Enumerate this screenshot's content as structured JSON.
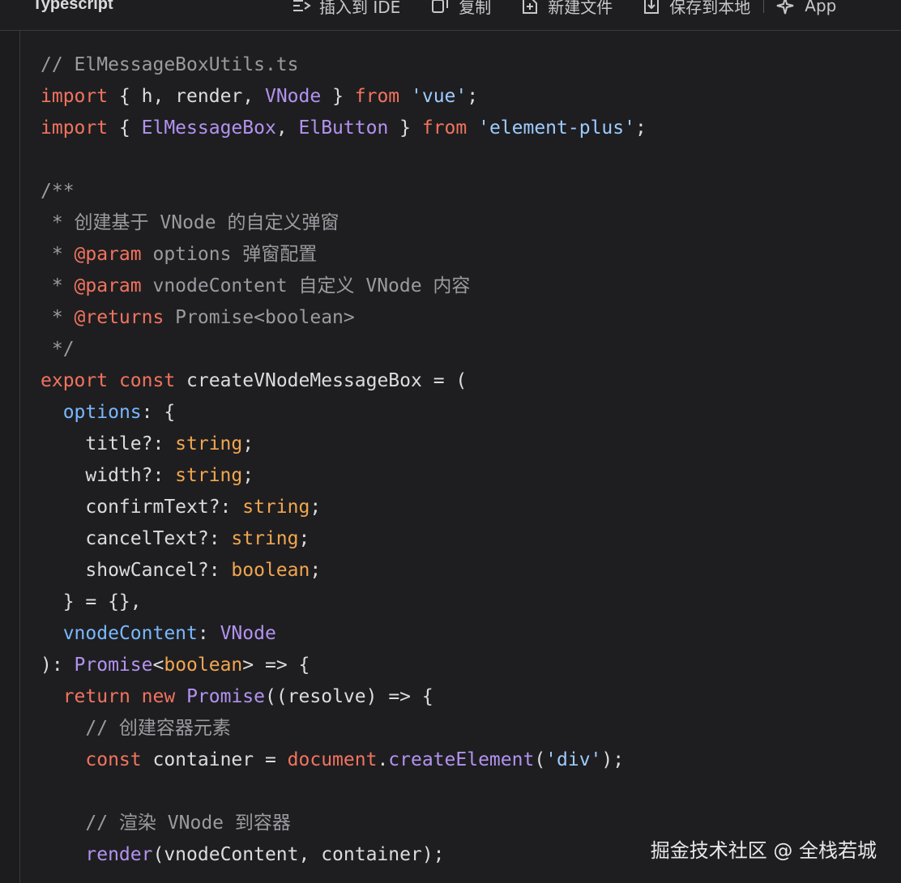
{
  "header": {
    "language": "Typescript",
    "toolbar": {
      "insert_label": "插入到 IDE",
      "copy_label": "复制",
      "new_file_label": "新建文件",
      "save_local_label": "保存到本地",
      "apply_label": "App"
    }
  },
  "code": {
    "lines": [
      [
        {
          "t": "// ElMessageBoxUtils.ts",
          "c": "c"
        }
      ],
      [
        {
          "t": "import",
          "c": "k"
        },
        {
          "t": " { h, render, ",
          "c": ""
        },
        {
          "t": "VNode",
          "c": "p"
        },
        {
          "t": " } ",
          "c": ""
        },
        {
          "t": "from",
          "c": "k"
        },
        {
          "t": " ",
          "c": ""
        },
        {
          "t": "'vue'",
          "c": "s"
        },
        {
          "t": ";",
          "c": ""
        }
      ],
      [
        {
          "t": "import",
          "c": "k"
        },
        {
          "t": " { ",
          "c": ""
        },
        {
          "t": "ElMessageBox",
          "c": "p"
        },
        {
          "t": ", ",
          "c": ""
        },
        {
          "t": "ElButton",
          "c": "p"
        },
        {
          "t": " } ",
          "c": ""
        },
        {
          "t": "from",
          "c": "k"
        },
        {
          "t": " ",
          "c": ""
        },
        {
          "t": "'element-plus'",
          "c": "s"
        },
        {
          "t": ";",
          "c": ""
        }
      ],
      [],
      [
        {
          "t": "/**",
          "c": "d"
        }
      ],
      [
        {
          "t": " * 创建基于 VNode 的自定义弹窗",
          "c": "d"
        }
      ],
      [
        {
          "t": " * ",
          "c": "d"
        },
        {
          "t": "@param",
          "c": "m"
        },
        {
          "t": " options 弹窗配置",
          "c": "d"
        }
      ],
      [
        {
          "t": " * ",
          "c": "d"
        },
        {
          "t": "@param",
          "c": "m"
        },
        {
          "t": " vnodeContent 自定义 VNode 内容",
          "c": "d"
        }
      ],
      [
        {
          "t": " * ",
          "c": "d"
        },
        {
          "t": "@returns",
          "c": "m"
        },
        {
          "t": " Promise<boolean>",
          "c": "d"
        }
      ],
      [
        {
          "t": " */",
          "c": "d"
        }
      ],
      [
        {
          "t": "export",
          "c": "k"
        },
        {
          "t": " ",
          "c": ""
        },
        {
          "t": "const",
          "c": "k"
        },
        {
          "t": " createVNodeMessageBox = (",
          "c": ""
        }
      ],
      [
        {
          "t": "  ",
          "c": ""
        },
        {
          "t": "options",
          "c": "b"
        },
        {
          "t": ": {",
          "c": ""
        }
      ],
      [
        {
          "t": "    title?: ",
          "c": ""
        },
        {
          "t": "string",
          "c": "t"
        },
        {
          "t": ";",
          "c": ""
        }
      ],
      [
        {
          "t": "    width?: ",
          "c": ""
        },
        {
          "t": "string",
          "c": "t"
        },
        {
          "t": ";",
          "c": ""
        }
      ],
      [
        {
          "t": "    confirmText?: ",
          "c": ""
        },
        {
          "t": "string",
          "c": "t"
        },
        {
          "t": ";",
          "c": ""
        }
      ],
      [
        {
          "t": "    cancelText?: ",
          "c": ""
        },
        {
          "t": "string",
          "c": "t"
        },
        {
          "t": ";",
          "c": ""
        }
      ],
      [
        {
          "t": "    showCancel?: ",
          "c": ""
        },
        {
          "t": "boolean",
          "c": "t"
        },
        {
          "t": ";",
          "c": ""
        }
      ],
      [
        {
          "t": "  } = {},",
          "c": ""
        }
      ],
      [
        {
          "t": "  ",
          "c": ""
        },
        {
          "t": "vnodeContent",
          "c": "b"
        },
        {
          "t": ": ",
          "c": ""
        },
        {
          "t": "VNode",
          "c": "p"
        }
      ],
      [
        {
          "t": "): ",
          "c": ""
        },
        {
          "t": "Promise",
          "c": "p"
        },
        {
          "t": "<",
          "c": ""
        },
        {
          "t": "boolean",
          "c": "t"
        },
        {
          "t": "> => {",
          "c": ""
        }
      ],
      [
        {
          "t": "  ",
          "c": ""
        },
        {
          "t": "return",
          "c": "k"
        },
        {
          "t": " ",
          "c": ""
        },
        {
          "t": "new",
          "c": "k"
        },
        {
          "t": " ",
          "c": ""
        },
        {
          "t": "Promise",
          "c": "p"
        },
        {
          "t": "((resolve) => {",
          "c": ""
        }
      ],
      [
        {
          "t": "    // 创建容器元素",
          "c": "c"
        }
      ],
      [
        {
          "t": "    ",
          "c": ""
        },
        {
          "t": "const",
          "c": "k"
        },
        {
          "t": " container = ",
          "c": ""
        },
        {
          "t": "document",
          "c": "k"
        },
        {
          "t": ".",
          "c": ""
        },
        {
          "t": "createElement",
          "c": "fn"
        },
        {
          "t": "(",
          "c": ""
        },
        {
          "t": "'div'",
          "c": "s"
        },
        {
          "t": ");",
          "c": ""
        }
      ],
      [],
      [
        {
          "t": "    // 渲染 VNode 到容器",
          "c": "c"
        }
      ],
      [
        {
          "t": "    ",
          "c": ""
        },
        {
          "t": "render",
          "c": "fn"
        },
        {
          "t": "(vnodeContent, container);",
          "c": ""
        }
      ]
    ]
  },
  "watermark": "掘金技术社区 @ 全栈若城",
  "colors": {
    "background": "#1e1e20",
    "keyword": "#f2735f",
    "string": "#9ecbff",
    "type": "#f2a64f",
    "identifier_purple": "#b392f0",
    "param_blue": "#79b8ff",
    "comment": "#9a9aa0"
  },
  "icons": {
    "insert": "insert-to-ide-icon",
    "copy": "copy-icon",
    "new_file": "new-file-icon",
    "save": "save-local-icon",
    "apply": "sparkle-icon"
  }
}
